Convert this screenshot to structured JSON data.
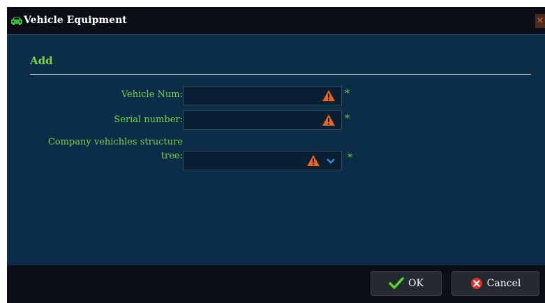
{
  "window": {
    "title": "Vehicle Equipment",
    "close_glyph": "×",
    "icon": "car-icon"
  },
  "form": {
    "section_title": "Add",
    "fields": [
      {
        "label": "Vehicle Num:",
        "value": "",
        "required_mark": "*",
        "status_icon": "warning-icon"
      },
      {
        "label": "Serial number:",
        "value": "",
        "required_mark": "*",
        "status_icon": "warning-icon"
      },
      {
        "label_line1": "Company vehichles structure",
        "label_line2": "tree:",
        "value": "",
        "required_mark": "*",
        "status_icon": "warning-icon",
        "dropdown_icon": "chevron-down-icon"
      }
    ]
  },
  "footer": {
    "ok_label": "OK",
    "cancel_label": "Cancel"
  },
  "colors": {
    "dialog_bg": "#0c2d48",
    "titlebar_bg": "#0b0e14",
    "label_green": "#7cd24a",
    "warning_orange": "#e8661e",
    "ok_green": "#5cd62a",
    "cancel_red": "#e0302c"
  }
}
